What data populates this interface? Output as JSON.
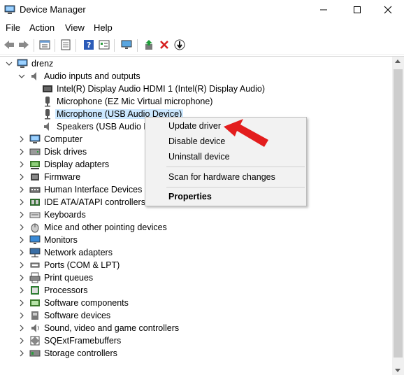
{
  "window": {
    "title": "Device Manager"
  },
  "menu": [
    "File",
    "Action",
    "View",
    "Help"
  ],
  "toolbar_icons": [
    "back-icon",
    "forward-icon",
    "properties-icon",
    "show-hidden-icon",
    "help-icon",
    "view-icon",
    "monitor-icon",
    "update-driver-icon",
    "uninstall-icon",
    "download-icon"
  ],
  "tree": {
    "root": "drenz",
    "audio_group": "Audio inputs and outputs",
    "audio_children": [
      "Intel(R) Display Audio HDMI 1 (Intel(R) Display Audio)",
      "Microphone (EZ Mic Virtual microphone)",
      "Microphone (USB Audio Device)",
      "Speakers (USB Audio Device)"
    ],
    "categories": [
      "Computer",
      "Disk drives",
      "Display adapters",
      "Firmware",
      "Human Interface Devices",
      "IDE ATA/ATAPI controllers",
      "Keyboards",
      "Mice and other pointing devices",
      "Monitors",
      "Network adapters",
      "Ports (COM & LPT)",
      "Print queues",
      "Processors",
      "Software components",
      "Software devices",
      "Sound, video and game controllers",
      "SQExtFramebuffers",
      "Storage controllers"
    ]
  },
  "context_menu": {
    "items": [
      "Update driver",
      "Disable device",
      "Uninstall device",
      "Scan for hardware changes",
      "Properties"
    ]
  },
  "colors": {
    "selection": "#cce8ff",
    "arrow": "#e31d1d",
    "menu_bg": "#f2f2f2"
  }
}
